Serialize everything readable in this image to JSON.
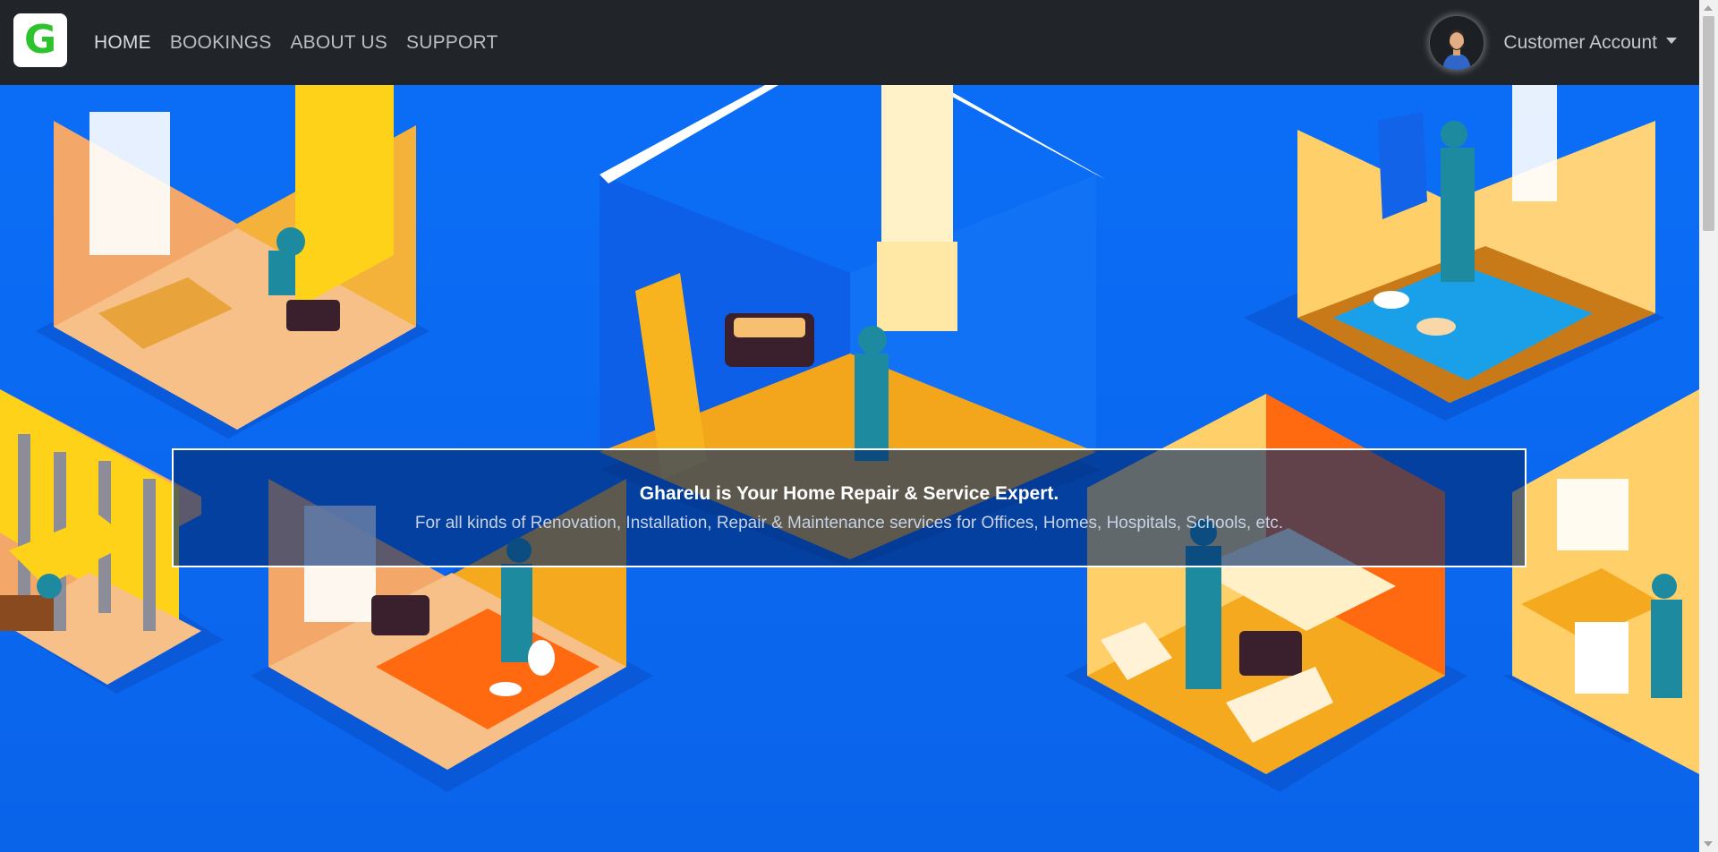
{
  "brand": {
    "letter": "G",
    "color": "#2cc32c"
  },
  "nav": {
    "items": [
      {
        "label": "HOME"
      },
      {
        "label": "BOOKINGS"
      },
      {
        "label": "ABOUT US"
      },
      {
        "label": "SUPPORT"
      }
    ]
  },
  "account": {
    "label": "Customer Account",
    "avatar_icon": "user-avatar-icon",
    "dropdown_icon": "caret-down-icon"
  },
  "hero": {
    "title": "Gharelu is Your Home Repair & Service Expert.",
    "subtitle": "For all kinds of Renovation, Installation, Repair & Maintenance services for Offices, Homes, Hospitals, Schools, etc.",
    "background_color": "#0a72f7"
  },
  "colors": {
    "navbar": "#212529",
    "nav_text": "#b9bec3",
    "accent_green": "#2cc32c"
  }
}
